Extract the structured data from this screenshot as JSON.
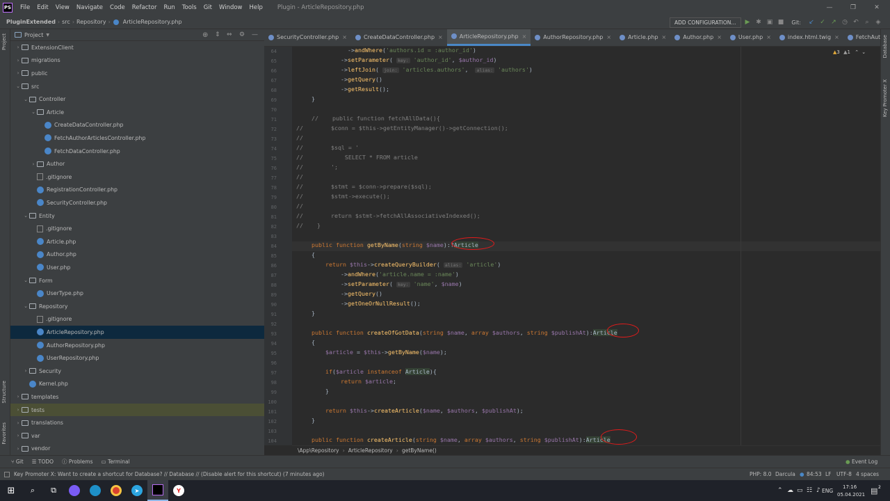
{
  "menubar": {
    "app_icon": "PS",
    "items": [
      "File",
      "Edit",
      "View",
      "Navigate",
      "Code",
      "Refactor",
      "Run",
      "Tools",
      "Git",
      "Window",
      "Help"
    ],
    "window_title": "Plugin - ArticleRepository.php",
    "controls": [
      "—",
      "❐",
      "✕"
    ]
  },
  "navbar": {
    "breadcrumb": [
      "PluginExtended",
      "src",
      "Repository",
      "ArticleRepository.php"
    ],
    "add_configuration": "ADD CONFIGURATION...",
    "git_label": "Git:"
  },
  "project_panel": {
    "title": "Project",
    "rows": [
      {
        "label": "ExtensionClient",
        "depth": 1,
        "type": "folder",
        "expanded": false
      },
      {
        "label": "migrations",
        "depth": 1,
        "type": "folder",
        "expanded": false
      },
      {
        "label": "public",
        "depth": 1,
        "type": "folder",
        "expanded": false
      },
      {
        "label": "src",
        "depth": 1,
        "type": "folder",
        "expanded": true
      },
      {
        "label": "Controller",
        "depth": 2,
        "type": "folder",
        "expanded": true
      },
      {
        "label": "Article",
        "depth": 3,
        "type": "folder",
        "expanded": true
      },
      {
        "label": "CreateDataController.php",
        "depth": 4,
        "type": "php"
      },
      {
        "label": "FetchAuthorArticlesController.php",
        "depth": 4,
        "type": "php"
      },
      {
        "label": "FetchDataController.php",
        "depth": 4,
        "type": "php"
      },
      {
        "label": "Author",
        "depth": 3,
        "type": "folder",
        "expanded": false
      },
      {
        "label": ".gitignore",
        "depth": 3,
        "type": "git"
      },
      {
        "label": "RegistrationController.php",
        "depth": 3,
        "type": "php"
      },
      {
        "label": "SecurityController.php",
        "depth": 3,
        "type": "php"
      },
      {
        "label": "Entity",
        "depth": 2,
        "type": "folder",
        "expanded": true
      },
      {
        "label": ".gitignore",
        "depth": 3,
        "type": "git"
      },
      {
        "label": "Article.php",
        "depth": 3,
        "type": "php"
      },
      {
        "label": "Author.php",
        "depth": 3,
        "type": "php"
      },
      {
        "label": "User.php",
        "depth": 3,
        "type": "php"
      },
      {
        "label": "Form",
        "depth": 2,
        "type": "folder",
        "expanded": true
      },
      {
        "label": "UserType.php",
        "depth": 3,
        "type": "php"
      },
      {
        "label": "Repository",
        "depth": 2,
        "type": "folder",
        "expanded": true
      },
      {
        "label": ".gitignore",
        "depth": 3,
        "type": "git"
      },
      {
        "label": "ArticleRepository.php",
        "depth": 3,
        "type": "php",
        "selected": true
      },
      {
        "label": "AuthorRepository.php",
        "depth": 3,
        "type": "php"
      },
      {
        "label": "UserRepository.php",
        "depth": 3,
        "type": "php"
      },
      {
        "label": "Security",
        "depth": 2,
        "type": "folder",
        "expanded": false
      },
      {
        "label": "Kernel.php",
        "depth": 2,
        "type": "php"
      },
      {
        "label": "templates",
        "depth": 1,
        "type": "folder",
        "expanded": false
      },
      {
        "label": "tests",
        "depth": 1,
        "type": "folder",
        "expanded": false,
        "highlight": true
      },
      {
        "label": "translations",
        "depth": 1,
        "type": "folder",
        "expanded": false
      },
      {
        "label": "var",
        "depth": 1,
        "type": "folder",
        "expanded": false
      },
      {
        "label": "vendor",
        "depth": 1,
        "type": "folder",
        "expanded": false
      }
    ]
  },
  "side_tabs": {
    "left": [
      "Project",
      "Structure",
      "Favorites"
    ],
    "right": [
      "Database",
      "Key Promoter X"
    ]
  },
  "editor_tabs": [
    {
      "label": "SecurityController.php",
      "active": false
    },
    {
      "label": "CreateDataController.php",
      "active": false
    },
    {
      "label": "ArticleRepository.php",
      "active": true
    },
    {
      "label": "AuthorRepository.php",
      "active": false
    },
    {
      "label": "Article.php",
      "active": false
    },
    {
      "label": "Author.php",
      "active": false
    },
    {
      "label": "User.php",
      "active": false
    },
    {
      "label": "index.html.twig",
      "active": false
    },
    {
      "label": "FetchAuthorArticlesContro",
      "active": false
    }
  ],
  "inspections": {
    "warnings": "3",
    "weak": "1"
  },
  "editor": {
    "line_numbers": [
      "64",
      "65",
      "66",
      "67",
      "68",
      "69",
      "70",
      "71",
      "72",
      "73",
      "74",
      "75",
      "76",
      "77",
      "78",
      "79",
      "80",
      "81",
      "82",
      "83",
      "84",
      "85",
      "86",
      "87",
      "88",
      "89",
      "90",
      "91",
      "92",
      "93",
      "94",
      "95",
      "96",
      "97",
      "98",
      "99",
      "100",
      "101",
      "102",
      "103",
      "104"
    ],
    "current_line_index": 20
  },
  "editor_breadcrumb": [
    "\\App\\Repository",
    "ArticleRepository",
    "getByName()"
  ],
  "bottom_tools": [
    "Git",
    "TODO",
    "Problems",
    "Terminal"
  ],
  "event_log": "Event Log",
  "status": {
    "message": "Key Promoter X: Want to create a shortcut for Database? // Database // (Disable alert for this shortcut) (7 minutes ago)",
    "php": "PHP: 8.0",
    "theme": "Darcula",
    "position": "84:53",
    "line_sep": "LF",
    "encoding": "UTF-8",
    "indent": "4 spaces"
  },
  "taskbar": {
    "lang": "ENG",
    "time": "17:16",
    "date": "05.04.2021",
    "notifications": "2"
  }
}
